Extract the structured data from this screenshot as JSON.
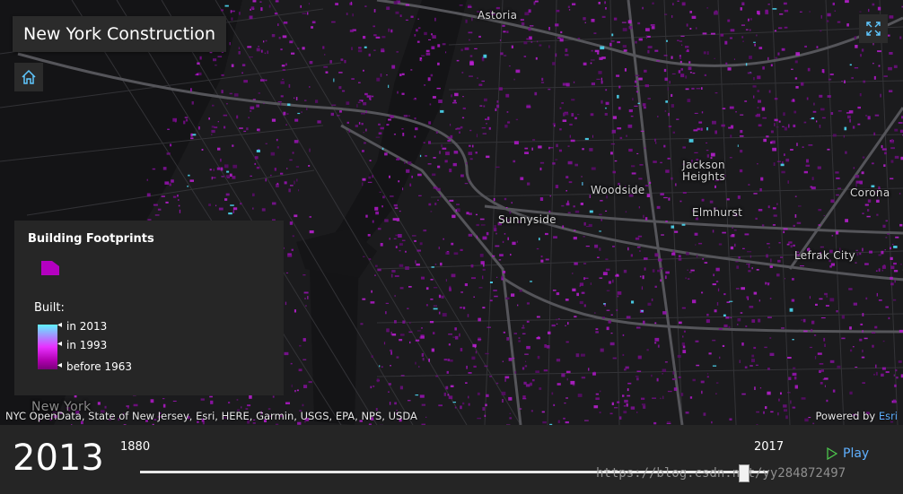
{
  "app": {
    "title": "New York Construction"
  },
  "legend": {
    "title": "Building Footprints",
    "built_label": "Built:",
    "ramp": [
      "in 2013",
      "in 1993",
      "before 1963"
    ],
    "colors": {
      "new": "#5ff3ff",
      "mid": "#e830ff",
      "old": "#7a007a"
    }
  },
  "places": [
    {
      "name": "Astoria"
    },
    {
      "name": "Jackson Heights"
    },
    {
      "name": "Woodside"
    },
    {
      "name": "Sunnyside"
    },
    {
      "name": "Elmhurst"
    },
    {
      "name": "Corona"
    },
    {
      "name": "Lefrak City"
    },
    {
      "name": "New York"
    }
  ],
  "attribution": {
    "text": "NYC OpenData, State of New Jersey, Esri, HERE, Garmin, USGS, EPA, NPS, USDA",
    "powered_by": "Powered by",
    "esri": "Esri"
  },
  "timeline": {
    "current_year": "2013",
    "start_year": "1880",
    "end_year": "2017",
    "progress": 0.962,
    "play_label": "Play"
  },
  "watermark": "https://blog.csdn.net/yy284872497",
  "icons": {
    "home": "home-icon",
    "fullscreen": "fullscreen-icon",
    "play": "play-icon"
  }
}
